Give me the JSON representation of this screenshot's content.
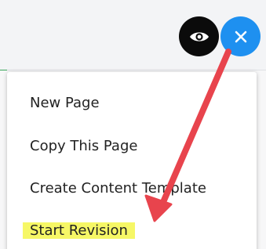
{
  "toolbar": {
    "preview_icon": "eye-icon",
    "close_icon": "close-icon",
    "close_color": "#1e90f0",
    "preview_color": "#0b0b0b"
  },
  "menu": {
    "items": [
      {
        "label": "New Page"
      },
      {
        "label": "Copy This Page"
      },
      {
        "label": "Create Content Template"
      },
      {
        "label": "Start Revision",
        "highlighted": true
      }
    ]
  },
  "annotation": {
    "arrow_color": "#e8444d",
    "highlight_color": "#f6f766"
  }
}
